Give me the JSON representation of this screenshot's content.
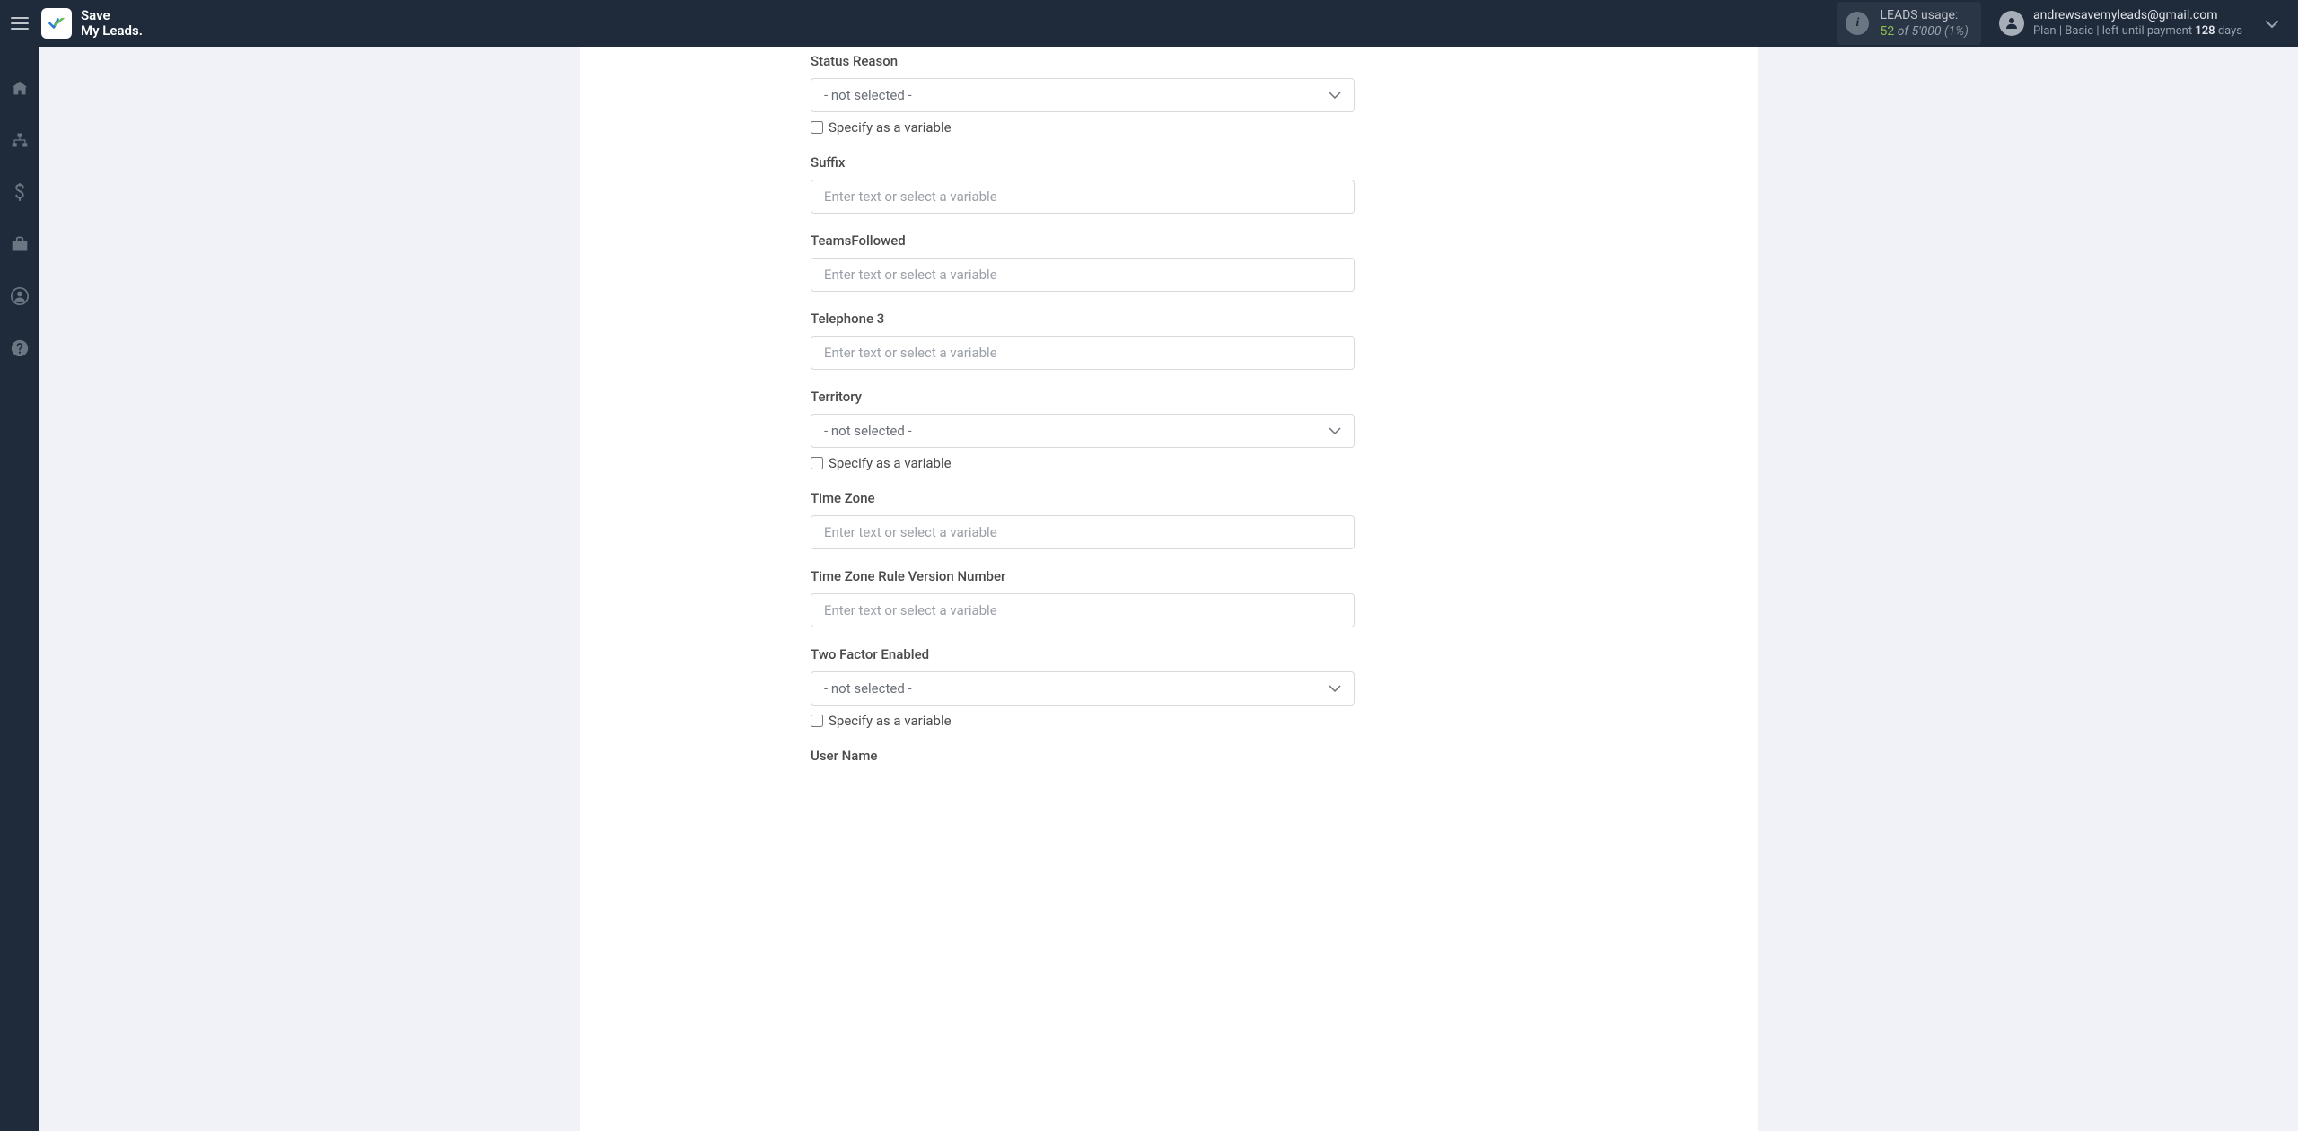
{
  "brand": {
    "line1": "Save",
    "line2": "My Leads."
  },
  "usage": {
    "label": "LEADS usage:",
    "count": "52",
    "of": "of",
    "total": "5'000",
    "percent": "(1%)"
  },
  "account": {
    "email": "andrewsavemyleads@gmail.com",
    "plan_prefix": "Plan |",
    "plan_name": "Basic",
    "plan_mid": "| left until payment",
    "days": "128",
    "days_label": "days"
  },
  "common": {
    "not_selected": "- not selected -",
    "placeholder": "Enter text or select a variable",
    "specify_variable": "Specify as a variable"
  },
  "fields": {
    "status_reason": {
      "label": "Status Reason"
    },
    "suffix": {
      "label": "Suffix"
    },
    "teams_followed": {
      "label": "TeamsFollowed"
    },
    "telephone_3": {
      "label": "Telephone 3"
    },
    "territory": {
      "label": "Territory"
    },
    "time_zone": {
      "label": "Time Zone"
    },
    "tz_rule_version": {
      "label": "Time Zone Rule Version Number"
    },
    "two_factor": {
      "label": "Two Factor Enabled"
    },
    "user_name": {
      "label": "User Name"
    }
  }
}
